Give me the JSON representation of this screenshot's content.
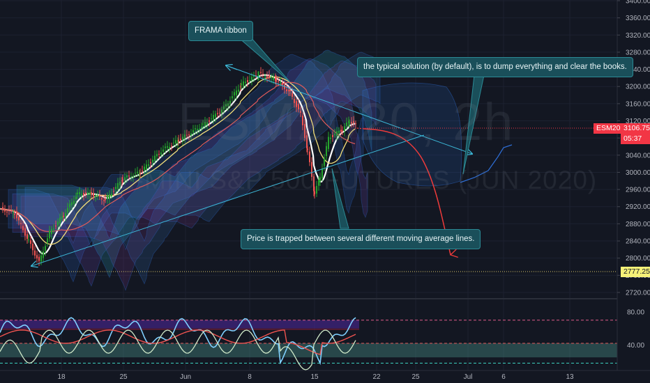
{
  "watermark": {
    "symbol": "ESM2020, 2h",
    "description": "E-MINI S&P 500 FUTURES (JUN 2020)"
  },
  "annotations": {
    "frama": "FRAMA ribbon",
    "solution": "the typical solution (by default), is to dump everything and clear the books.",
    "trapped": "Price is trapped between several different moving average lines."
  },
  "price_axis": {
    "ticks": [
      "3400.00",
      "3360.00",
      "3320.00",
      "3280.00",
      "3240.00",
      "3200.00",
      "3160.00",
      "3120.00",
      "3080.00",
      "3040.00",
      "3000.00",
      "2960.00",
      "2920.00",
      "2880.00",
      "2840.00",
      "2800.00",
      "2760.00",
      "2720.00"
    ],
    "symbol_tag": "ESM2020",
    "last_price": "3106.75",
    "countdown": "05:37",
    "level_price": "2777.25"
  },
  "osc_axis": {
    "ticks": [
      "80.00",
      "40.00"
    ]
  },
  "time_axis": {
    "ticks": [
      "18",
      "25",
      "Jun",
      "8",
      "15",
      "22",
      "25",
      "Jul",
      "6",
      "13"
    ]
  },
  "colors": {
    "background": "#131722",
    "candle_up": "#26a42d",
    "candle_down": "#ef5350",
    "price_tag": "#f23645",
    "level_tag": "#f5f178",
    "annotation_bg": "#1a4f5a",
    "trend_line": "#3cb8d8",
    "arrow": "#ef3b3b"
  }
}
